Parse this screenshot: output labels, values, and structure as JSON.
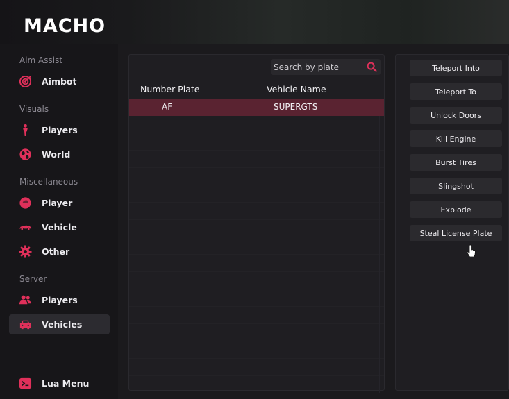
{
  "app": {
    "title": "MACHO"
  },
  "sidebar": {
    "sections": [
      {
        "label": "Aim Assist"
      },
      {
        "label": "Visuals"
      },
      {
        "label": "Miscellaneous"
      },
      {
        "label": "Server"
      }
    ],
    "items": [
      {
        "label": "Aimbot",
        "icon": "target-icon"
      },
      {
        "label": "Players",
        "icon": "person-icon"
      },
      {
        "label": "World",
        "icon": "globe-icon"
      },
      {
        "label": "Player",
        "icon": "player-head-icon"
      },
      {
        "label": "Vehicle",
        "icon": "car-icon"
      },
      {
        "label": "Other",
        "icon": "gear-icon"
      },
      {
        "label": "Players",
        "icon": "users-icon"
      },
      {
        "label": "Vehicles",
        "icon": "car-front-icon",
        "active": true
      },
      {
        "label": "Lua Menu",
        "icon": "terminal-icon"
      }
    ]
  },
  "search": {
    "placeholder": "Search by plate",
    "value": ""
  },
  "table": {
    "columns": [
      "Number Plate",
      "Vehicle Name"
    ],
    "rows": [
      {
        "plate": "AF",
        "name": "SUPERGTS",
        "selected": true
      }
    ]
  },
  "actions": [
    "Teleport Into",
    "Teleport To",
    "Unlock Doors",
    "Kill Engine",
    "Burst Tires",
    "Slingshot",
    "Explode",
    "Steal License Plate"
  ],
  "colors": {
    "accent": "#e0305a",
    "selected_row": "#5a2331",
    "background": "#121114"
  }
}
